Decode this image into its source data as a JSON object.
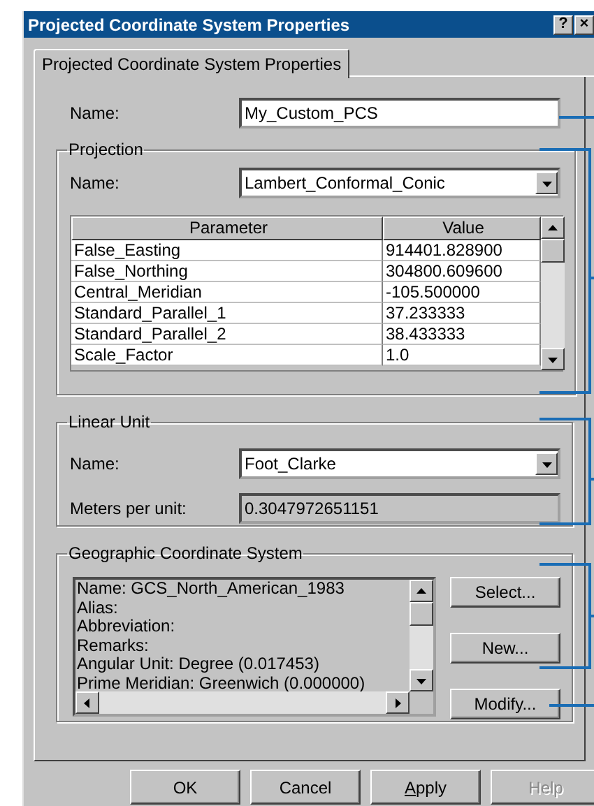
{
  "window": {
    "title": "Projected Coordinate System Properties",
    "title_buttons": [
      "?",
      "×"
    ]
  },
  "tabs": [
    {
      "label": "Projected Coordinate System Properties",
      "selected": true
    }
  ],
  "name_field": {
    "label": "Name:",
    "value": "My_Custom_PCS"
  },
  "projection": {
    "title": "Projection",
    "name_label": "Name:",
    "name_value": "Lambert_Conformal_Conic",
    "table": {
      "columns": [
        "Parameter",
        "Value"
      ],
      "rows": [
        [
          "False_Easting",
          "914401.828900"
        ],
        [
          "False_Northing",
          "304800.609600"
        ],
        [
          "Central_Meridian",
          "-105.500000"
        ],
        [
          "Standard_Parallel_1",
          "37.233333"
        ],
        [
          "Standard_Parallel_2",
          "38.433333"
        ],
        [
          "Scale_Factor",
          "1.0"
        ]
      ]
    }
  },
  "linear_unit": {
    "title": "Linear Unit",
    "name_label": "Name:",
    "name_value": "Foot_Clarke",
    "meters_label": "Meters per unit:",
    "meters_value": "0.3047972651151"
  },
  "gcs": {
    "title": "Geographic Coordinate System",
    "lines": [
      "Name: GCS_North_American_1983",
      "Alias:",
      "Abbreviation:",
      "Remarks:",
      "Angular Unit: Degree (0.017453)",
      "Prime Meridian: Greenwich (0.000000)"
    ],
    "buttons": [
      "Select...",
      "New...",
      "Modify..."
    ]
  },
  "buttons": [
    {
      "label": "OK",
      "disabled": false,
      "mnemonic": false
    },
    {
      "label": "Cancel",
      "disabled": false,
      "mnemonic": false
    },
    {
      "label": "Apply",
      "disabled": false,
      "mnemonic": true
    },
    {
      "label": "Help",
      "disabled": true,
      "mnemonic": false
    }
  ]
}
